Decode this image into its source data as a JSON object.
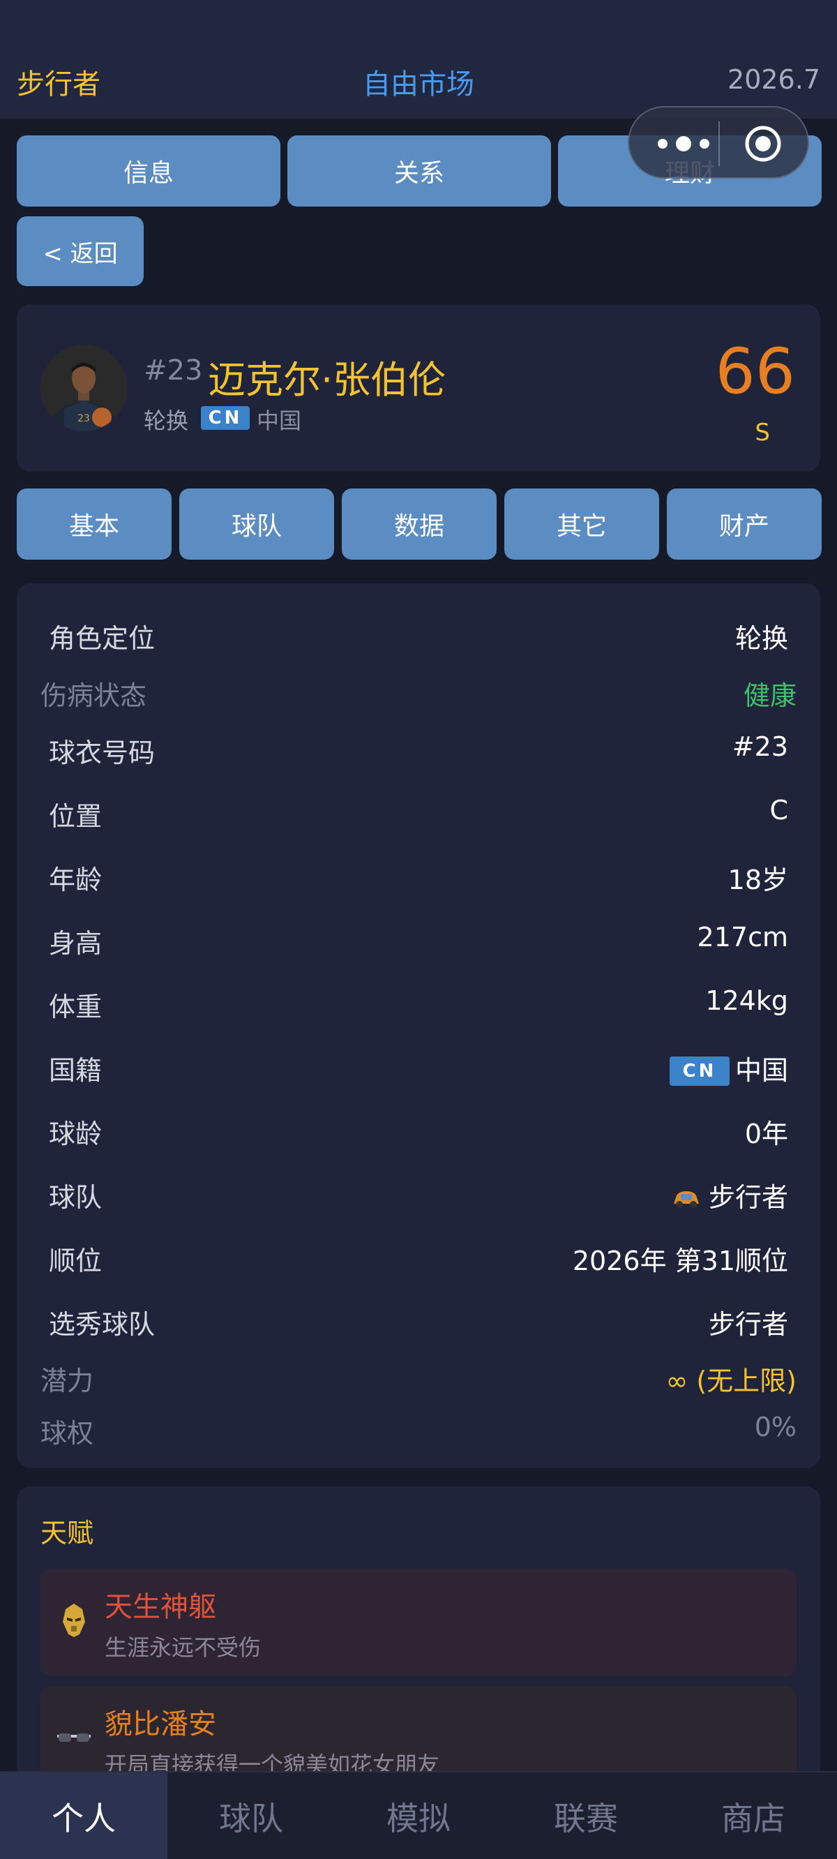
{
  "header": {
    "team": "步行者",
    "title": "自由市场",
    "date": "2026.7"
  },
  "top_tabs": [
    "信息",
    "关系",
    "理财"
  ],
  "back_label": "< 返回",
  "profile": {
    "number": "#23",
    "name": "迈克尔·张伯伦",
    "role": "轮换",
    "flag": "CN",
    "nationality": "中国",
    "rating": "66",
    "grade": "S"
  },
  "sub_tabs": [
    "基本",
    "球队",
    "数据",
    "其它",
    "财产"
  ],
  "info_rows": {
    "role": {
      "label": "角色定位",
      "value": "轮换"
    },
    "injury": {
      "label": "伤病状态",
      "value": "健康"
    },
    "jersey": {
      "label": "球衣号码",
      "value": "#23"
    },
    "position": {
      "label": "位置",
      "value": "C"
    },
    "age": {
      "label": "年龄",
      "value": "18岁"
    },
    "height": {
      "label": "身高",
      "value": "217cm"
    },
    "weight": {
      "label": "体重",
      "value": "124kg"
    },
    "nationality": {
      "label": "国籍",
      "flag": "CN",
      "value": "中国"
    },
    "experience": {
      "label": "球龄",
      "value": "0年"
    },
    "team": {
      "label": "球队",
      "value": "步行者"
    },
    "draft": {
      "label": "顺位",
      "value": "2026年 第31顺位"
    },
    "draft_team": {
      "label": "选秀球队",
      "value": "步行者"
    },
    "potential": {
      "label": "潜力",
      "value": "∞ (无上限)"
    },
    "stake": {
      "label": "球权",
      "value": "0%"
    }
  },
  "talent": {
    "title": "天赋",
    "items": [
      {
        "name": "天生神躯",
        "desc": "生涯永远不受伤",
        "icon": "golden-mask-icon",
        "color": "#e0523a"
      },
      {
        "name": "貌比潘安",
        "desc": "开局直接获得一个貌美如花女朋友",
        "icon": "sunglasses-icon",
        "color": "#e67e22"
      }
    ]
  },
  "bottom_nav": [
    "个人",
    "球队",
    "模拟",
    "联赛",
    "商店"
  ],
  "colors": {
    "accent_gold": "#f4c430",
    "accent_blue": "#4a9bf0",
    "button_blue": "#5b8cc2",
    "healthy_green": "#3fbf6a",
    "rating_orange": "#e67e22",
    "background": "#161a28",
    "card": "#20243a"
  }
}
